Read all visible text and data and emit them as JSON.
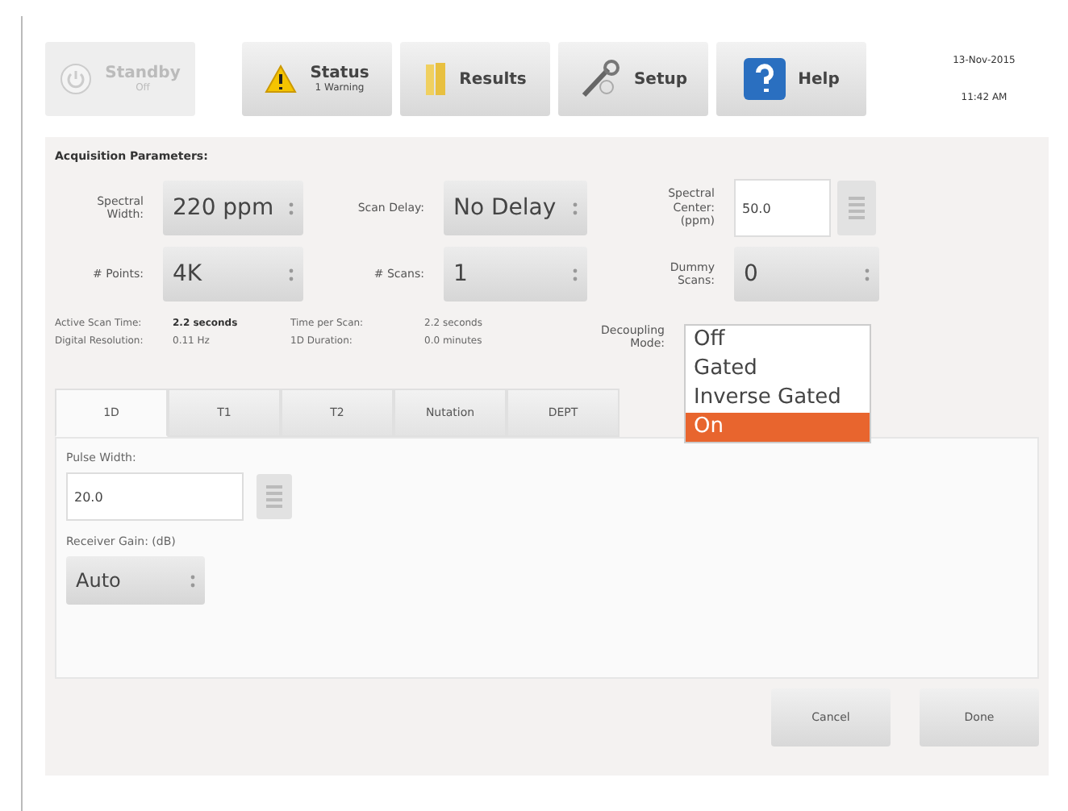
{
  "toolbar": {
    "buttons": [
      {
        "label": "Standby",
        "sublabel": "Off",
        "kind": "power",
        "disabled": true
      },
      {
        "label": "Status",
        "sublabel": "1 Warning",
        "kind": "warning",
        "disabled": false
      },
      {
        "label": "Results",
        "kind": "results",
        "disabled": false
      },
      {
        "label": "Setup",
        "kind": "setup",
        "disabled": false
      },
      {
        "label": "Help",
        "kind": "help",
        "disabled": false
      }
    ],
    "date": "13-Nov-2015",
    "time": "11:42 AM"
  },
  "acquisition": {
    "title": "Acquisition Parameters:",
    "fields": [
      {
        "label": "Spectral Width:",
        "kind": "select",
        "value": "220 ppm"
      },
      {
        "label": "Scan Delay:",
        "kind": "select",
        "value": "No Delay"
      },
      {
        "label": "Spectral Center: (ppm)",
        "kind": "input",
        "value": "50.0"
      },
      {
        "label": "# Points:",
        "kind": "select",
        "value": "4K"
      },
      {
        "label": "# Scans:",
        "kind": "select",
        "value": "1"
      },
      {
        "label": "Dummy Scans:",
        "kind": "select",
        "value": "0"
      }
    ],
    "info": [
      {
        "label": "Active Scan Time:",
        "value": "2.2 seconds",
        "bold": true
      },
      {
        "label": "Time per Scan:",
        "value": "2.2 seconds",
        "bold": false
      },
      {
        "label": "Digital Resolution:",
        "value": "0.11 Hz",
        "bold": false
      },
      {
        "label": "1D Duration:",
        "value": "0.0 minutes",
        "bold": false
      }
    ],
    "decoupling": {
      "label": "Decoupling Mode:",
      "options": [
        {
          "label": "Off",
          "selected": false
        },
        {
          "label": "Gated",
          "selected": false
        },
        {
          "label": "Inverse Gated",
          "selected": false
        },
        {
          "label": "On",
          "selected": true
        }
      ]
    }
  },
  "tabs": [
    {
      "label": "1D",
      "selected": true
    },
    {
      "label": "T1",
      "selected": false
    },
    {
      "label": "T2",
      "selected": false
    },
    {
      "label": "Nutation",
      "selected": false
    },
    {
      "label": "DEPT",
      "selected": false
    }
  ],
  "tab_content": {
    "pulse_width": {
      "label": "Pulse Width:",
      "value": "20.0"
    },
    "receiver_gain": {
      "label": "Receiver Gain: (dB)",
      "value": "Auto"
    }
  },
  "buttons": [
    "Cancel",
    "Done"
  ]
}
